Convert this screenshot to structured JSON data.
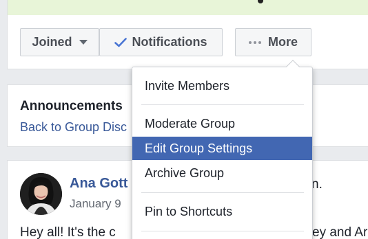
{
  "header": {
    "joined_label": "Joined",
    "notifications_label": "Notifications",
    "more_label": "More"
  },
  "announcements": {
    "title": "Announcements",
    "link": "Back to Group Disc"
  },
  "post": {
    "author": "Ana Gott",
    "author_suffix": "n.",
    "date": "January 9",
    "text": "Hey all! It's the c",
    "text_right": "ey and Ar"
  },
  "menu": {
    "items": [
      {
        "label": "Invite Members"
      },
      {
        "label": "Moderate Group"
      },
      {
        "label": "Edit Group Settings"
      },
      {
        "label": "Archive Group"
      },
      {
        "label": "Pin to Shortcuts"
      }
    ],
    "active_index": 2
  },
  "colors": {
    "link": "#385898",
    "menu_highlight": "#4267b2",
    "check": "#4a76d4",
    "background": "#e9ebee"
  },
  "icons": {
    "joined": "caret-down-icon",
    "notifications": "checkmark-icon",
    "more": "ellipsis-icon"
  }
}
